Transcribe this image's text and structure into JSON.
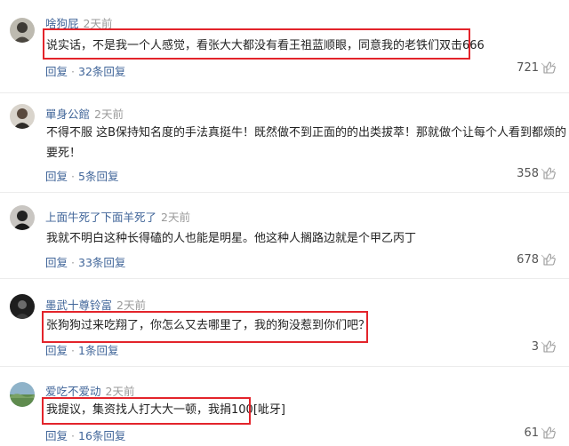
{
  "comments": [
    {
      "username": "啥狗屁",
      "time": "2天前",
      "text_lines": [
        "说实话，不是我一个人感觉，看张大大都没有看王祖蓝顺眼，同意我的老铁们双击666"
      ],
      "reply_label": "回复",
      "replies_label": "32条回复",
      "likes": "721",
      "highlighted": true
    },
    {
      "username": "單身公館",
      "time": "2天前",
      "text_lines": [
        "不得不服 这B保持知名度的手法真挺牛！既然做不到正面的的出类拔萃！那就做个让每个人看到都烦的",
        "要死！"
      ],
      "reply_label": "回复",
      "replies_label": "5条回复",
      "likes": "358",
      "highlighted": false
    },
    {
      "username": "上面牛死了下面羊死了",
      "time": "2天前",
      "text_lines": [
        "我就不明白这种长得磕的人也能是明星。他这种人搁路边就是个甲乙丙丁"
      ],
      "reply_label": "回复",
      "replies_label": "33条回复",
      "likes": "678",
      "highlighted": false
    },
    {
      "username": "墨武十尊铃富",
      "time": "2天前",
      "text_lines": [
        "张狗狗过来吃翔了，你怎么又去哪里了，我的狗没惹到你们吧？"
      ],
      "reply_label": "回复",
      "replies_label": "1条回复",
      "likes": "3",
      "highlighted": true
    },
    {
      "username": "爱吃不爱动",
      "time": "2天前",
      "text_lines": [
        "我提议，集资找人打大大一顿，我捐100[呲牙]"
      ],
      "reply_label": "回复",
      "replies_label": "16条回复",
      "likes": "61",
      "highlighted": true
    }
  ],
  "colors": {
    "username": "#406599",
    "highlight": "#e3242b",
    "time": "#9a9a9a"
  },
  "icons": {
    "like": "thumbs-up-icon",
    "more": "chevron-down-icon"
  }
}
